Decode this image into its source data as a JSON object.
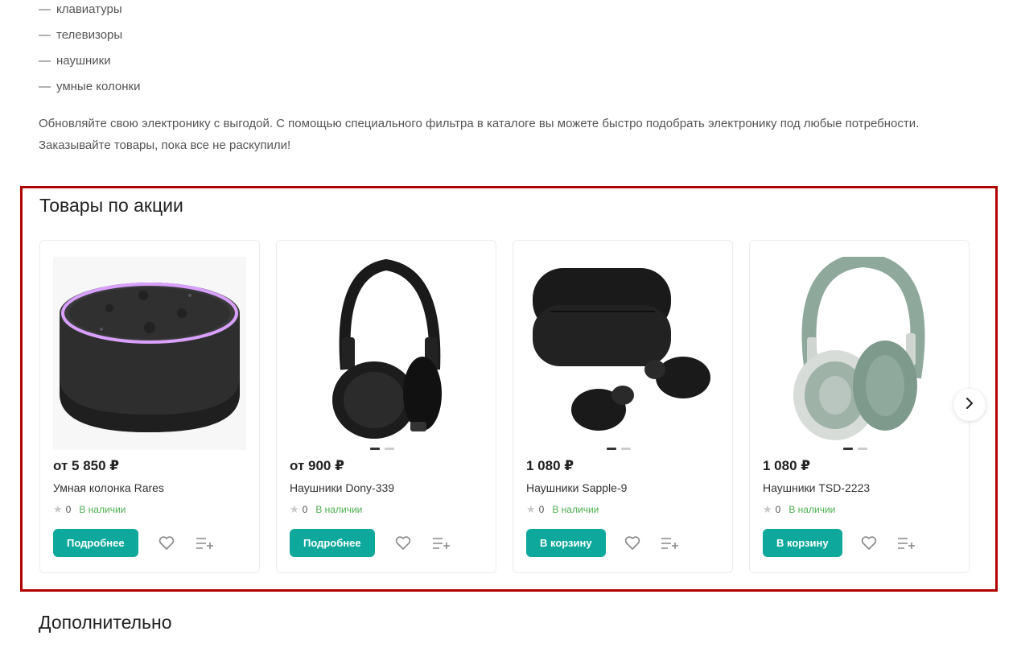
{
  "categories": [
    "клавиатуры",
    "телевизоры",
    "наушники",
    "умные колонки"
  ],
  "list_marker": "—",
  "intro_text": "Обновляйте свою электронику с выгодой. С помощью специального фильтра в каталоге вы можете быстро подобрать электронику под любые потребности. Заказывайте товары, пока все не раскупили!",
  "promo": {
    "title": "Товары по акции",
    "products": [
      {
        "price": "от 5 850 ₽",
        "name": "Умная колонка Rares",
        "rating": "0",
        "stock": "В наличии",
        "button": "Подробнее",
        "image": "smart-speaker"
      },
      {
        "price": "от 900 ₽",
        "name": "Наушники Dony-339",
        "rating": "0",
        "stock": "В наличии",
        "button": "Подробнее",
        "image": "black-headphones"
      },
      {
        "price": "1 080 ₽",
        "name": "Наушники Sapple-9",
        "rating": "0",
        "stock": "В наличии",
        "button": "В корзину",
        "image": "wireless-earbuds"
      },
      {
        "price": "1 080 ₽",
        "name": "Наушники TSD-2223",
        "rating": "0",
        "stock": "В наличии",
        "button": "В корзину",
        "image": "green-headphones"
      }
    ]
  },
  "more_title": "Дополнительно",
  "colors": {
    "accent": "#0ea99c",
    "stock": "#4caf50",
    "highlight_border": "#b00000"
  },
  "icons": {
    "star": "star-icon",
    "favorite": "heart-icon",
    "compare": "compare-list-icon",
    "next": "chevron-right-icon"
  }
}
